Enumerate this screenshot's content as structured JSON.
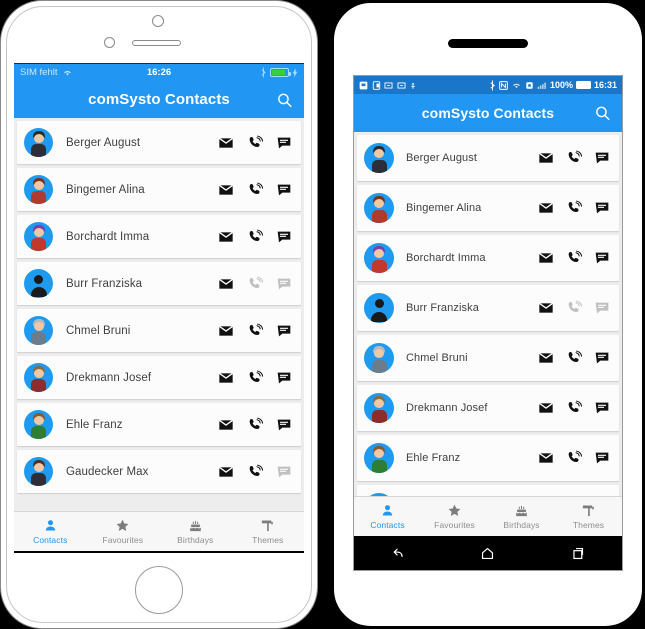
{
  "app": {
    "title": "comSysto Contacts",
    "accent_color": "#2196f3",
    "search_icon": "search-icon"
  },
  "ios": {
    "status": {
      "carrier": "SIM fehlt",
      "wifi_icon": "wifi-icon",
      "clock": "16:26",
      "bluetooth_icon": "bluetooth-icon",
      "battery_icon": "battery-charging-icon"
    }
  },
  "android": {
    "status": {
      "clock": "16:31",
      "battery_percent": "100%",
      "left_icons": [
        "sd-card-icon",
        "sim-icon",
        "screenshot-icon",
        "screenshot-icon",
        "usb-icon"
      ],
      "right_icons": [
        "bluetooth-icon",
        "nfc-icon",
        "wifi-icon",
        "vpn-icon",
        "signal-icon"
      ],
      "battery_icon": "battery-full-icon"
    },
    "navbar": {
      "back": "back-nav-icon",
      "home": "home-nav-icon",
      "recents": "recents-nav-icon"
    }
  },
  "contacts": [
    {
      "name": "Berger August",
      "avatar": "cartoon",
      "hair": "#2b2b2b",
      "body": "#2e2e38",
      "mail": true,
      "call": true,
      "message": true
    },
    {
      "name": "Bingemer Alina",
      "avatar": "cartoon",
      "hair": "#7a3322",
      "body": "#b03a2e",
      "mail": true,
      "call": true,
      "message": true
    },
    {
      "name": "Borchardt Imma",
      "avatar": "cartoon",
      "hair": "#7a3fa8",
      "body": "#c0392b",
      "mail": true,
      "call": true,
      "message": true
    },
    {
      "name": "Burr Franziska",
      "avatar": "generic",
      "hair": "",
      "body": "",
      "mail": true,
      "call": false,
      "message": false
    },
    {
      "name": "Chmel Bruni",
      "avatar": "cartoon",
      "hair": "#b9b9b9",
      "body": "#6b7c8c",
      "mail": true,
      "call": true,
      "message": true
    },
    {
      "name": "Drekmann Josef",
      "avatar": "cartoon",
      "hair": "#8a6b43",
      "body": "#8e2b2b",
      "mail": true,
      "call": true,
      "message": true
    },
    {
      "name": "Ehle Franz",
      "avatar": "cartoon",
      "hair": "#8a5a2b",
      "body": "#2f7d32",
      "mail": true,
      "call": true,
      "message": true
    },
    {
      "name": "Gaudecker Max",
      "avatar": "cartoon",
      "hair": "#4a3526",
      "body": "#2e2e38",
      "mail": true,
      "call": true,
      "message": false
    }
  ],
  "row_actions": {
    "mail_icon": "mail-icon",
    "call_icon": "phone-icon",
    "message_icon": "message-icon"
  },
  "tabs": [
    {
      "label": "Contacts",
      "icon": "person-icon",
      "active": true
    },
    {
      "label": "Favourites",
      "icon": "star-icon",
      "active": false
    },
    {
      "label": "Birthdays",
      "icon": "cake-icon",
      "active": false
    },
    {
      "label": "Themes",
      "icon": "paintroller-icon",
      "active": false
    }
  ]
}
